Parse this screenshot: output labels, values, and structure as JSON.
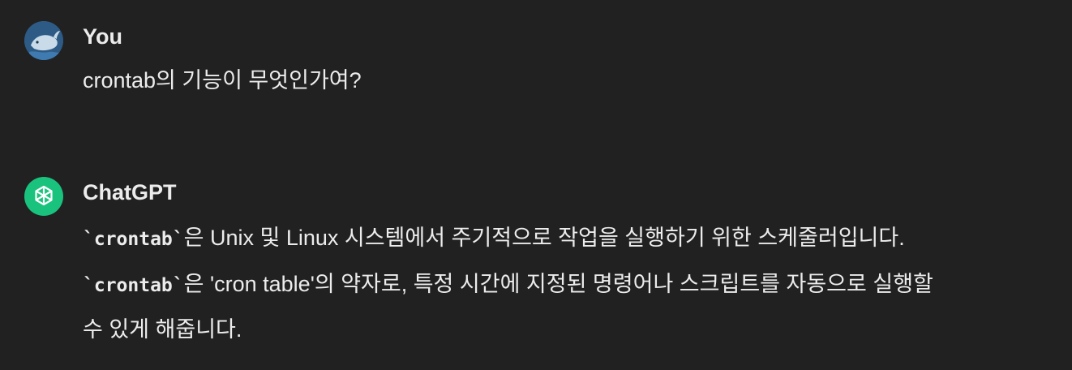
{
  "conversation": {
    "user": {
      "name": "You",
      "avatar_icon": "whale-avatar-icon",
      "message": "crontab의 기능이 무엇인가여?"
    },
    "assistant": {
      "name": "ChatGPT",
      "avatar_icon": "openai-logo-icon",
      "accent_color": "#19c37d",
      "lines": [
        {
          "code": "`crontab`",
          "text": "은 Unix 및 Linux 시스템에서 주기적으로 작업을 실행하기 위한 스케줄러입니다."
        },
        {
          "code": "`crontab`",
          "text": "은 'cron table'의 약자로, 특정 시간에 지정된 명령어나 스크립트를 자동으로 실행할"
        },
        {
          "text": "수 있게 해줍니다."
        }
      ]
    }
  },
  "theme": {
    "background": "#212121",
    "text": "#ececec"
  }
}
